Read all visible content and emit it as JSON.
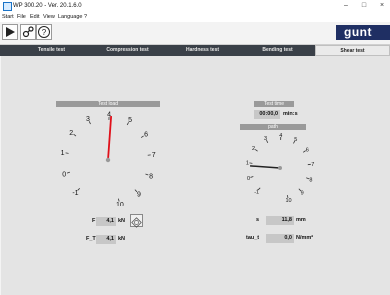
{
  "window": {
    "title": "WP 300.20 - Ver. 20.1.6.0",
    "minimize": "–",
    "maximize": "□",
    "close": "×"
  },
  "menu": [
    "Start",
    "File",
    "Edit",
    "View",
    "Language",
    "?"
  ],
  "brand": {
    "logo_text": "gunt",
    "accent": "#1f2f63"
  },
  "tabs": [
    {
      "label": "Tensile test",
      "active": false
    },
    {
      "label": "Compression test",
      "active": false
    },
    {
      "label": "Hardness test",
      "active": false
    },
    {
      "label": "Bending test",
      "active": false
    },
    {
      "label": "Shear test",
      "active": true
    }
  ],
  "gauges": {
    "load": {
      "title": "Test load",
      "ticks": [
        "-1",
        "0",
        "1",
        "2",
        "3",
        "4",
        "5",
        "6",
        "7",
        "8",
        "9",
        "10"
      ],
      "value": 4.1,
      "needle_color": "#e0101a"
    },
    "path": {
      "title": "path",
      "ticks": [
        "-1",
        "0",
        "1",
        "2",
        "3",
        "4",
        "5",
        "6",
        "7",
        "8",
        "9",
        "10"
      ],
      "value": 11.8,
      "needle_color": "#222222"
    }
  },
  "test_time": {
    "label": "Test time",
    "value": "00:00,0",
    "unit": "min:s"
  },
  "readouts": {
    "F": {
      "label": "F",
      "value": "4,1",
      "unit": "kN"
    },
    "F_T": {
      "label": "F_T",
      "value": "4,1",
      "unit": "kN"
    },
    "s": {
      "label": "s",
      "value": "11,8",
      "unit": "mm"
    },
    "tau": {
      "label": "tau_t",
      "value": "0,0",
      "unit": "N/mm²"
    }
  }
}
